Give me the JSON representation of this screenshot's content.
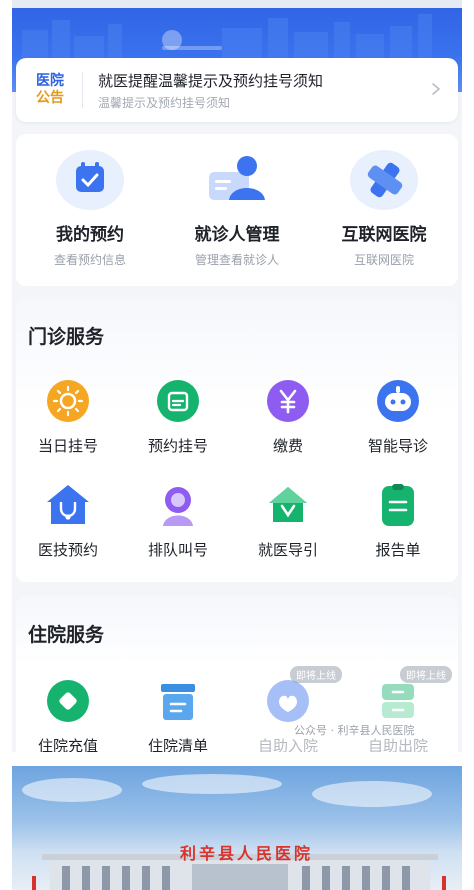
{
  "notice": {
    "badge_line1": "医院",
    "badge_line2": "公告",
    "title": "就医提醒温馨提示及预约挂号须知",
    "subtitle": "温馨提示及预约挂号须知",
    "icon": "chevron-right-icon"
  },
  "quick": [
    {
      "title": "我的预约",
      "subtitle": "查看预约信息",
      "icon": "calendar-check-icon"
    },
    {
      "title": "就诊人管理",
      "subtitle": "管理查看就诊人",
      "icon": "patient-card-icon"
    },
    {
      "title": "互联网医院",
      "subtitle": "互联网医院",
      "icon": "medical-cross-icon"
    }
  ],
  "outpatient": {
    "title": "门诊服务",
    "items": [
      {
        "label": "当日挂号",
        "icon": "sun-icon",
        "color": "#f5a623"
      },
      {
        "label": "预约挂号",
        "icon": "calendar-icon",
        "color": "#16b36e"
      },
      {
        "label": "缴费",
        "icon": "yen-icon",
        "color": "#8e5cf0"
      },
      {
        "label": "智能导诊",
        "icon": "robot-icon",
        "color": "#3b74ee"
      },
      {
        "label": "医技预约",
        "icon": "stethoscope-house-icon",
        "color": "#3b74ee"
      },
      {
        "label": "排队叫号",
        "icon": "queue-person-icon",
        "color": "#8e5cf0"
      },
      {
        "label": "就医导引",
        "icon": "guide-house-icon",
        "color": "#16b36e"
      },
      {
        "label": "报告单",
        "icon": "report-icon",
        "color": "#16b36e"
      }
    ]
  },
  "inpatient": {
    "title": "住院服务",
    "items": [
      {
        "label": "住院充值",
        "icon": "diamond-icon",
        "color": "#16b36e",
        "badge": ""
      },
      {
        "label": "住院清单",
        "icon": "list-box-icon",
        "color": "#3b8fe0",
        "badge": ""
      },
      {
        "label": "自助入院",
        "icon": "hand-heart-icon",
        "color": "#3b74ee",
        "badge": "即将上线"
      },
      {
        "label": "自助出院",
        "icon": "drawer-icon",
        "color": "#16b36e",
        "badge": "即将上线"
      }
    ]
  },
  "watermark": "公众号 · 利辛县人民医院",
  "photo": {
    "building_sign": "利辛县人民医院"
  }
}
